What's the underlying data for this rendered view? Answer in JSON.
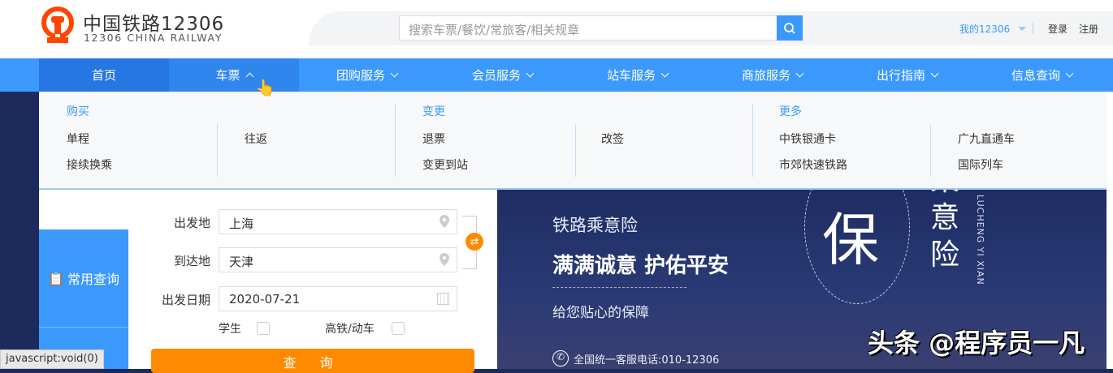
{
  "header": {
    "logo_cn": "中国铁路12306",
    "logo_en": "12306 CHINA RAILWAY",
    "search_placeholder": "搜索车票/餐饮/常旅客/相关规章",
    "my12306": "我的12306",
    "login": "登录",
    "register": "注册"
  },
  "nav": [
    {
      "label": "首页"
    },
    {
      "label": "车票"
    },
    {
      "label": "团购服务"
    },
    {
      "label": "会员服务"
    },
    {
      "label": "站车服务"
    },
    {
      "label": "商旅服务"
    },
    {
      "label": "出行指南"
    },
    {
      "label": "信息查询"
    }
  ],
  "dropdown": {
    "buy": {
      "title": "购买",
      "items": [
        "单程",
        "往返",
        "接续换乘"
      ]
    },
    "change": {
      "title": "变更",
      "items": [
        "退票",
        "改签",
        "变更到站"
      ]
    },
    "more": {
      "title": "更多",
      "items": [
        "中铁银通卡",
        "广九直通车",
        "市郊快速铁路",
        "国际列车"
      ]
    }
  },
  "form": {
    "side_tab": "常用查询",
    "from_label": "出发地",
    "from_value": "上海",
    "to_label": "到达地",
    "to_value": "天津",
    "date_label": "出发日期",
    "date_value": "2020-07-21",
    "student_label": "学生",
    "gaotie_label": "高铁/动车",
    "query_button": "查 询"
  },
  "banner": {
    "line1": "铁路乘意险",
    "line2": "满满诚意 护佑平安",
    "line3": "给您贴心的保障",
    "hotline": "全国统一客服电话:010-12306",
    "bao": "保",
    "vertical": "乘意险",
    "pinyin": "LUCHENG YI XIAN"
  },
  "watermark": "头条 @程序员一凡",
  "status_bar": "javascript:void(0)",
  "colors": {
    "primary": "#3b99fc",
    "accent": "#ff8a00",
    "logo": "#ff4500"
  }
}
